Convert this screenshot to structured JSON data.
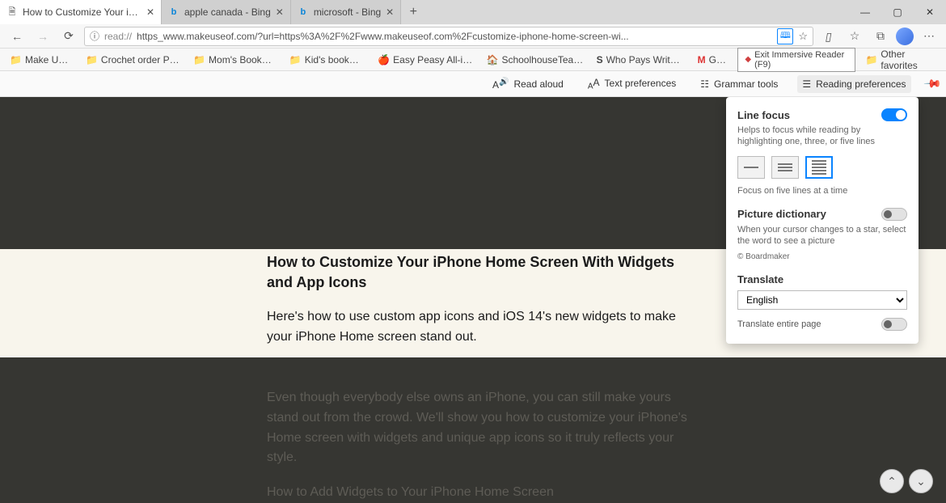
{
  "tabs": [
    {
      "label": "How to Customize Your iPhone H"
    },
    {
      "label": "apple canada - Bing"
    },
    {
      "label": "microsoft - Bing"
    }
  ],
  "toolbar": {
    "url_prefix": "read://",
    "url": "https_www.makeuseof.com/?url=https%3A%2F%2Fwww.makeuseof.com%2Fcustomize-iphone-home-screen-wi..."
  },
  "bookmarks": [
    {
      "icon": "folder",
      "label": "Make Use Of"
    },
    {
      "icon": "folder",
      "label": "Crochet order Patte..."
    },
    {
      "icon": "folder",
      "label": "Mom's Bookmarks"
    },
    {
      "icon": "folder",
      "label": "Kid's bookmarks"
    },
    {
      "icon": "site",
      "label": "Easy Peasy All-in-O..."
    },
    {
      "icon": "site",
      "label": "SchoolhouseTeache..."
    },
    {
      "icon": "s",
      "label": "Who Pays Writers?..."
    },
    {
      "icon": "m",
      "label": "Gmail"
    }
  ],
  "exit_reader": "Exit Immersive Reader (F9)",
  "other_favorites": "Other favorites",
  "reader_bar": {
    "read_aloud": "Read aloud",
    "text_prefs": "Text preferences",
    "grammar": "Grammar tools",
    "reading_prefs": "Reading preferences"
  },
  "article": {
    "heading": "How to Customize Your iPhone Home Screen With Widgets and App Icons",
    "p1": "Here's how to use custom app icons and iOS 14's new widgets to make your iPhone Home screen stand out.",
    "p2": "Even though everybody else owns an iPhone, you can still make yours stand out from the crowd. We'll show you how to customize your iPhone's Home screen with widgets and unique app icons so it truly reflects your style.",
    "p3": "How to Add Widgets to Your iPhone Home Screen"
  },
  "panel": {
    "line_focus": {
      "title": "Line focus",
      "desc": "Helps to focus while reading by highlighting one, three, or five lines",
      "status": "Focus on five lines at a time"
    },
    "picture_dict": {
      "title": "Picture dictionary",
      "desc": "When your cursor changes to a star, select the word to see a picture",
      "credit": "© Boardmaker"
    },
    "translate": {
      "title": "Translate",
      "selected": "English",
      "entire": "Translate entire page"
    }
  }
}
